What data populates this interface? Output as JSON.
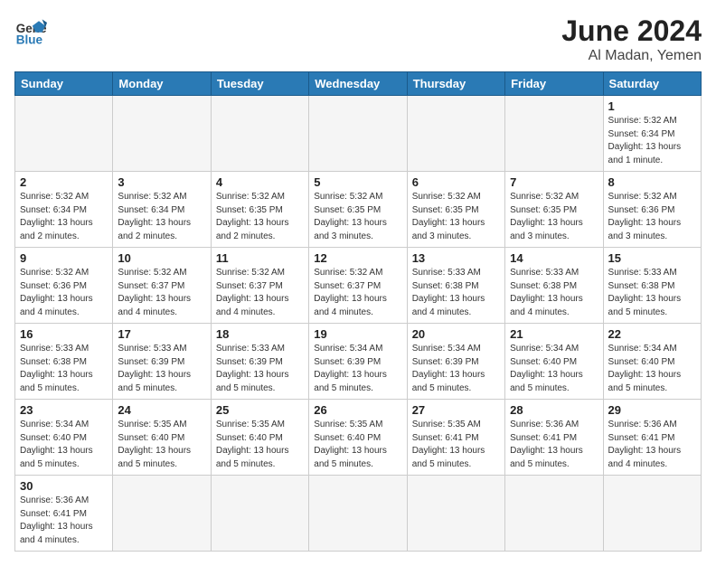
{
  "header": {
    "logo_text_general": "General",
    "logo_text_blue": "Blue",
    "title": "June 2024",
    "subtitle": "Al Madan, Yemen"
  },
  "days_of_week": [
    "Sunday",
    "Monday",
    "Tuesday",
    "Wednesday",
    "Thursday",
    "Friday",
    "Saturday"
  ],
  "weeks": [
    [
      {
        "day": "",
        "info": ""
      },
      {
        "day": "",
        "info": ""
      },
      {
        "day": "",
        "info": ""
      },
      {
        "day": "",
        "info": ""
      },
      {
        "day": "",
        "info": ""
      },
      {
        "day": "",
        "info": ""
      },
      {
        "day": "1",
        "info": "Sunrise: 5:32 AM\nSunset: 6:34 PM\nDaylight: 13 hours and 1 minute."
      }
    ],
    [
      {
        "day": "2",
        "info": "Sunrise: 5:32 AM\nSunset: 6:34 PM\nDaylight: 13 hours and 2 minutes."
      },
      {
        "day": "3",
        "info": "Sunrise: 5:32 AM\nSunset: 6:34 PM\nDaylight: 13 hours and 2 minutes."
      },
      {
        "day": "4",
        "info": "Sunrise: 5:32 AM\nSunset: 6:35 PM\nDaylight: 13 hours and 2 minutes."
      },
      {
        "day": "5",
        "info": "Sunrise: 5:32 AM\nSunset: 6:35 PM\nDaylight: 13 hours and 3 minutes."
      },
      {
        "day": "6",
        "info": "Sunrise: 5:32 AM\nSunset: 6:35 PM\nDaylight: 13 hours and 3 minutes."
      },
      {
        "day": "7",
        "info": "Sunrise: 5:32 AM\nSunset: 6:35 PM\nDaylight: 13 hours and 3 minutes."
      },
      {
        "day": "8",
        "info": "Sunrise: 5:32 AM\nSunset: 6:36 PM\nDaylight: 13 hours and 3 minutes."
      }
    ],
    [
      {
        "day": "9",
        "info": "Sunrise: 5:32 AM\nSunset: 6:36 PM\nDaylight: 13 hours and 4 minutes."
      },
      {
        "day": "10",
        "info": "Sunrise: 5:32 AM\nSunset: 6:37 PM\nDaylight: 13 hours and 4 minutes."
      },
      {
        "day": "11",
        "info": "Sunrise: 5:32 AM\nSunset: 6:37 PM\nDaylight: 13 hours and 4 minutes."
      },
      {
        "day": "12",
        "info": "Sunrise: 5:32 AM\nSunset: 6:37 PM\nDaylight: 13 hours and 4 minutes."
      },
      {
        "day": "13",
        "info": "Sunrise: 5:33 AM\nSunset: 6:38 PM\nDaylight: 13 hours and 4 minutes."
      },
      {
        "day": "14",
        "info": "Sunrise: 5:33 AM\nSunset: 6:38 PM\nDaylight: 13 hours and 4 minutes."
      },
      {
        "day": "15",
        "info": "Sunrise: 5:33 AM\nSunset: 6:38 PM\nDaylight: 13 hours and 5 minutes."
      }
    ],
    [
      {
        "day": "16",
        "info": "Sunrise: 5:33 AM\nSunset: 6:38 PM\nDaylight: 13 hours and 5 minutes."
      },
      {
        "day": "17",
        "info": "Sunrise: 5:33 AM\nSunset: 6:39 PM\nDaylight: 13 hours and 5 minutes."
      },
      {
        "day": "18",
        "info": "Sunrise: 5:33 AM\nSunset: 6:39 PM\nDaylight: 13 hours and 5 minutes."
      },
      {
        "day": "19",
        "info": "Sunrise: 5:34 AM\nSunset: 6:39 PM\nDaylight: 13 hours and 5 minutes."
      },
      {
        "day": "20",
        "info": "Sunrise: 5:34 AM\nSunset: 6:39 PM\nDaylight: 13 hours and 5 minutes."
      },
      {
        "day": "21",
        "info": "Sunrise: 5:34 AM\nSunset: 6:40 PM\nDaylight: 13 hours and 5 minutes."
      },
      {
        "day": "22",
        "info": "Sunrise: 5:34 AM\nSunset: 6:40 PM\nDaylight: 13 hours and 5 minutes."
      }
    ],
    [
      {
        "day": "23",
        "info": "Sunrise: 5:34 AM\nSunset: 6:40 PM\nDaylight: 13 hours and 5 minutes."
      },
      {
        "day": "24",
        "info": "Sunrise: 5:35 AM\nSunset: 6:40 PM\nDaylight: 13 hours and 5 minutes."
      },
      {
        "day": "25",
        "info": "Sunrise: 5:35 AM\nSunset: 6:40 PM\nDaylight: 13 hours and 5 minutes."
      },
      {
        "day": "26",
        "info": "Sunrise: 5:35 AM\nSunset: 6:40 PM\nDaylight: 13 hours and 5 minutes."
      },
      {
        "day": "27",
        "info": "Sunrise: 5:35 AM\nSunset: 6:41 PM\nDaylight: 13 hours and 5 minutes."
      },
      {
        "day": "28",
        "info": "Sunrise: 5:36 AM\nSunset: 6:41 PM\nDaylight: 13 hours and 5 minutes."
      },
      {
        "day": "29",
        "info": "Sunrise: 5:36 AM\nSunset: 6:41 PM\nDaylight: 13 hours and 4 minutes."
      }
    ],
    [
      {
        "day": "30",
        "info": "Sunrise: 5:36 AM\nSunset: 6:41 PM\nDaylight: 13 hours and 4 minutes."
      },
      {
        "day": "",
        "info": ""
      },
      {
        "day": "",
        "info": ""
      },
      {
        "day": "",
        "info": ""
      },
      {
        "day": "",
        "info": ""
      },
      {
        "day": "",
        "info": ""
      },
      {
        "day": "",
        "info": ""
      }
    ]
  ]
}
